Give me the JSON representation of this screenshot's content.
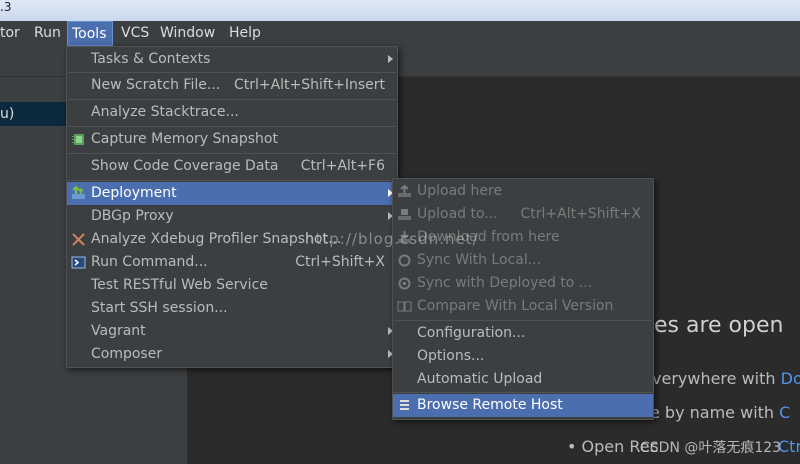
{
  "titlebar": {
    "text": ".3"
  },
  "menubar": {
    "items": [
      "tor",
      "Run",
      "Tools",
      "VCS",
      "Window",
      "Help"
    ],
    "active": "Tools"
  },
  "left_panel": {
    "selected_item": "u)"
  },
  "tools_menu": [
    {
      "label": "Tasks & Contexts",
      "shortcut": "",
      "submenu": true
    },
    {
      "label": "New Scratch File...",
      "shortcut": "Ctrl+Alt+Shift+Insert",
      "submenu": false
    },
    {
      "label": "Analyze Stacktrace...",
      "shortcut": "",
      "submenu": false
    },
    {
      "label": "Capture Memory Snapshot",
      "shortcut": "",
      "submenu": false,
      "icon": "memory-snapshot-icon"
    },
    {
      "label": "Show Code Coverage Data",
      "shortcut": "Ctrl+Alt+F6",
      "submenu": false
    },
    {
      "label": "Deployment",
      "shortcut": "",
      "submenu": true,
      "icon": "deployment-icon",
      "highlighted": true
    },
    {
      "label": "DBGp Proxy",
      "shortcut": "",
      "submenu": true
    },
    {
      "label": "Analyze Xdebug Profiler Snapshot...",
      "shortcut": "",
      "submenu": false,
      "icon": "xdebug-icon"
    },
    {
      "label": "Run Command...",
      "shortcut": "Ctrl+Shift+X",
      "submenu": false,
      "icon": "terminal-icon"
    },
    {
      "label": "Test RESTful Web Service",
      "shortcut": "",
      "submenu": false
    },
    {
      "label": "Start SSH session...",
      "shortcut": "",
      "submenu": false
    },
    {
      "label": "Vagrant",
      "shortcut": "",
      "submenu": true
    },
    {
      "label": "Composer",
      "shortcut": "",
      "submenu": true
    }
  ],
  "deployment_menu": [
    {
      "label": "Upload here",
      "shortcut": "",
      "disabled": true,
      "icon": "upload-icon"
    },
    {
      "label": "Upload to...",
      "shortcut": "Ctrl+Alt+Shift+X",
      "disabled": true,
      "icon": "upload-to-icon"
    },
    {
      "label": "Download from here",
      "shortcut": "",
      "disabled": true,
      "icon": "download-icon"
    },
    {
      "label": "Sync With Local...",
      "shortcut": "",
      "disabled": true,
      "icon": "sync-icon"
    },
    {
      "label": "Sync with Deployed to ...",
      "shortcut": "",
      "disabled": true,
      "icon": "sync-deployed-icon"
    },
    {
      "label": "Compare With Local Version",
      "shortcut": "",
      "disabled": true,
      "icon": "compare-icon"
    },
    {
      "label": "Configuration...",
      "shortcut": "",
      "disabled": false
    },
    {
      "label": "Options...",
      "shortcut": "",
      "disabled": false
    },
    {
      "label": "Automatic Upload",
      "shortcut": "",
      "disabled": false
    },
    {
      "label": "Browse Remote Host",
      "shortcut": "",
      "disabled": false,
      "icon": "remote-host-icon",
      "highlighted": true
    }
  ],
  "welcome": {
    "title": "es are open",
    "line1_text": "verywhere with",
    "line1_key": "Do",
    "line2_text": "e by name with",
    "line2_key": "C",
    "line3_text": "• Open Rec",
    "line3_key": "Ctr"
  },
  "watermark": {
    "url": "http://blog.csdn.net/",
    "credit": "CSDN @叶落无痕123"
  },
  "colors": {
    "accent": "#4b6eaf",
    "link": "#5394ec",
    "background": "#2b2b2b",
    "menu": "#3c3f41"
  }
}
